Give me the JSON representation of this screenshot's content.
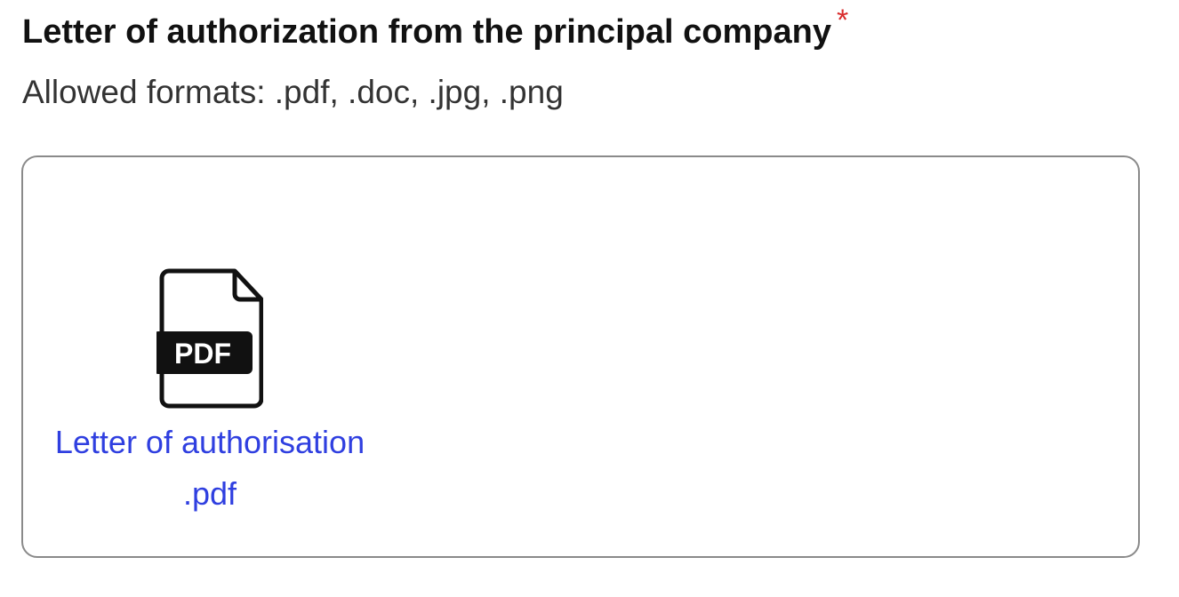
{
  "field": {
    "label": "Letter of authorization from the principal company",
    "required_marker": "*",
    "allowed_formats_hint": "Allowed formats: .pdf, .doc, .jpg, .png"
  },
  "uploads": {
    "files": [
      {
        "icon": "pdf-file-icon",
        "badge_text": "PDF",
        "name": "Letter of authorisation .pdf"
      }
    ]
  },
  "colors": {
    "required": "#d92b2b",
    "link": "#2f3fe0",
    "border": "#8a8a8a"
  }
}
